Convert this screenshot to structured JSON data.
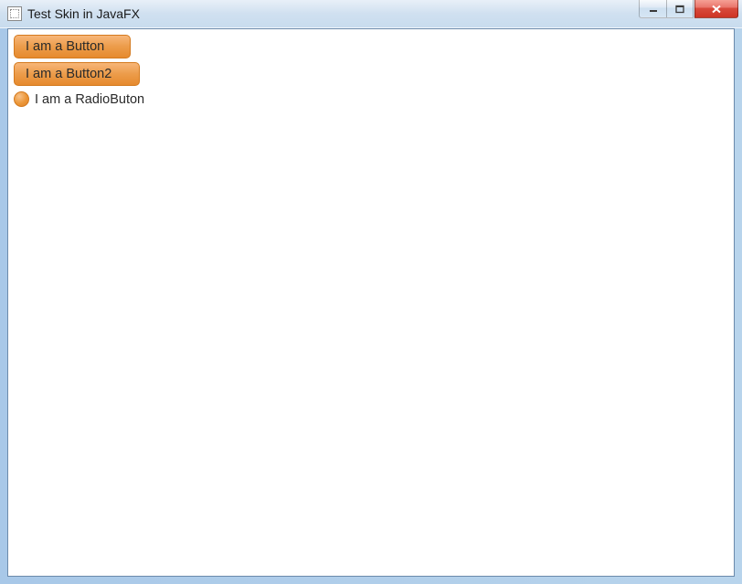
{
  "window": {
    "title": "Test Skin in JavaFX"
  },
  "content": {
    "button1_label": "I am a Button",
    "button2_label": "I am a Button2",
    "radio_label": "I am a RadioButon"
  }
}
